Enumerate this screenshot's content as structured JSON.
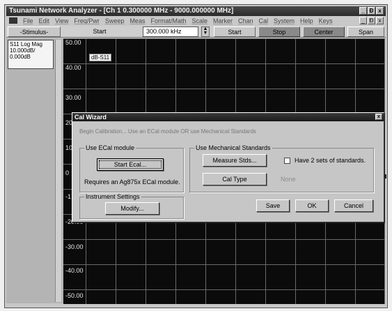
{
  "window": {
    "title": "Tsunami Network Analyzer - [Ch 1 0.300000 MHz - 9000.000000 MHz]",
    "title_controls": [
      "_",
      "Ɖ",
      "x"
    ],
    "menu": [
      "File",
      "Edit",
      "View",
      "Freq/Pwr",
      "Sweep",
      "Meas",
      "Format/Math",
      "Scale",
      "Marker",
      "Chan",
      "Cal",
      "System",
      "Help",
      "Keys"
    ],
    "menu_controls": [
      "_",
      "Ɖ",
      "x"
    ]
  },
  "toolbar": {
    "stimulus_label": "-Stimulus-",
    "start_label": "Start",
    "start_value": "300.000 kHz",
    "start_button": "Start",
    "stop_button": "Stop",
    "center_button": "Center",
    "span_button": "Span"
  },
  "trace": {
    "lines": [
      "S11 Log Mag",
      "10.000dB/",
      "0.000dB"
    ],
    "plot_label": "dB-S11"
  },
  "plot": {
    "y_labels": [
      "50.00",
      "40.00",
      "30.00",
      "20",
      "10",
      "0",
      "-1",
      "-20.00",
      "-30.00",
      "-40.00",
      "-50.00"
    ]
  },
  "dialog": {
    "title": "Cal Wizard",
    "close": "x",
    "intro": "Begin Calibration... Use an ECal module OR use Mechanical Standards",
    "ecal_group": "Use ECal module",
    "start_ecal_button": "Start Ecal...",
    "ecal_requirement": "Requires an Ag875x ECal module.",
    "instrument_group": "Instrument Settings",
    "modify_button": "Modify...",
    "mech_group": "Use Mechanical Standards",
    "measure_stds_button": "Measure Stds...",
    "two_sets_label": "Have 2 sets of standards.",
    "cal_type_button": "Cal Type",
    "cal_type_value": "None",
    "save_button": "Save",
    "ok_button": "OK",
    "cancel_button": "Cancel"
  }
}
